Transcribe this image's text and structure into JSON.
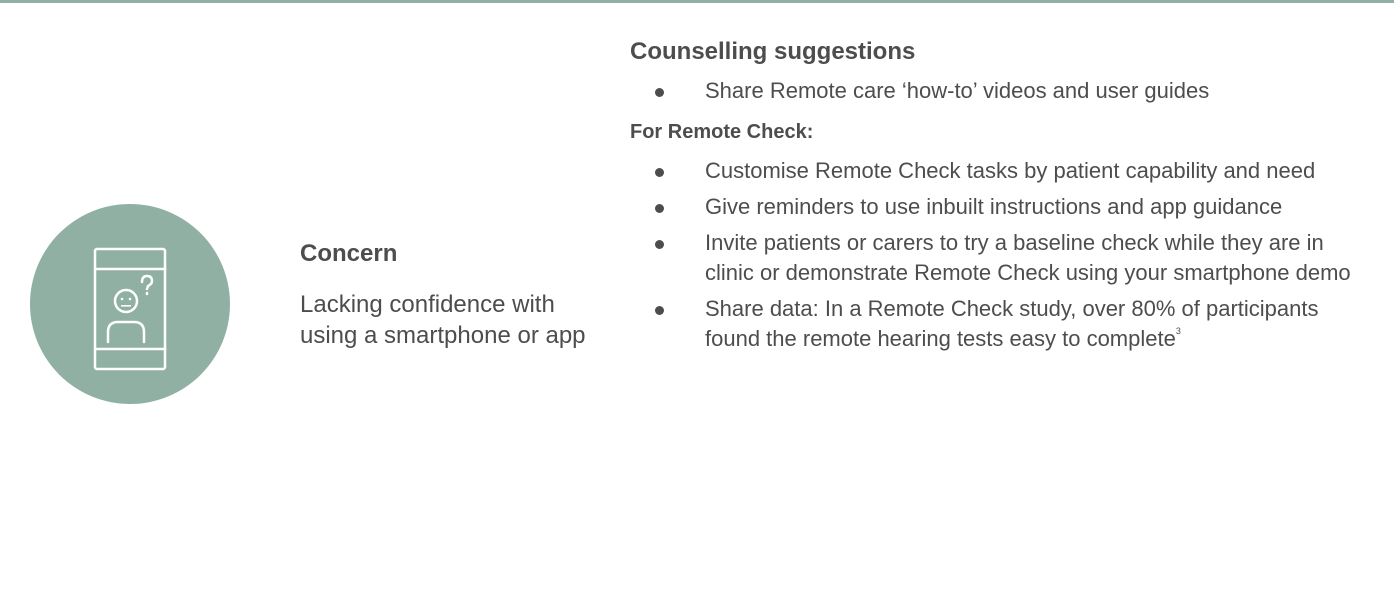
{
  "concern": {
    "icon": "smartphone-confused-face-icon",
    "title": "Concern",
    "text": "Lacking confidence with using a smartphone or app"
  },
  "suggestions": {
    "title": "Counselling suggestions",
    "general_items": [
      "Share Remote care ‘how-to’ videos and user guides"
    ],
    "remote_check_heading": "For Remote Check:",
    "remote_check_items": [
      "Customise Remote Check tasks by patient capability and need",
      "Give reminders to use inbuilt instructions and app guidance",
      "Invite patients or carers to try a baseline check while they are in clinic or demonstrate Remote Check using your smartphone demo",
      "Share data: In a Remote Check study, over 80% of participants found the remote hearing tests easy to complete"
    ],
    "footnote_ref": "3"
  },
  "colors": {
    "accent": "#8fb0a3",
    "text": "#4d4d4d",
    "background": "#ffffff"
  }
}
